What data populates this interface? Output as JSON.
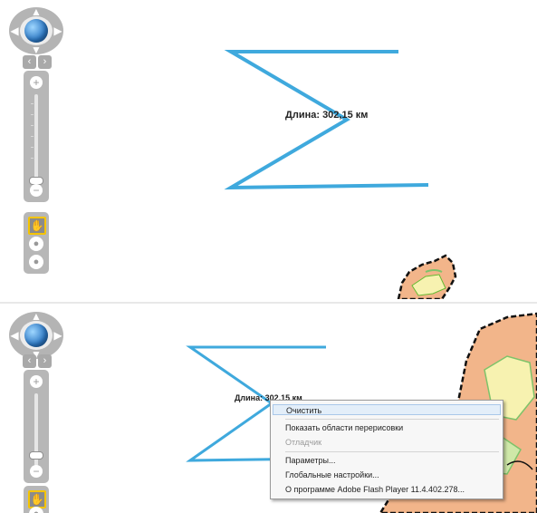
{
  "colors": {
    "measure_line": "#3fa9dd",
    "map_border": "#111111",
    "map_fill": "#f2b58a",
    "map_green": "#7ec36a",
    "accent_selected": "#f5c400"
  },
  "panels": [
    {
      "measure_label": "Длина: 302,15 км",
      "nav_icons": {
        "pan_up": "chevron-up-icon",
        "pan_down": "chevron-down-icon",
        "pan_left": "chevron-left-icon",
        "pan_right": "chevron-right-icon",
        "globe": "globe-icon",
        "rotate_left": "rotate-left-icon",
        "rotate_right": "rotate-right-icon",
        "zoom_in": "plus-icon",
        "zoom_out": "minus-icon",
        "hand": "hand-icon",
        "tool2": "circle-tool-icon",
        "tool3": "circle-tool-icon"
      },
      "zoom_level": 0.2
    },
    {
      "measure_label": "Длина: 302,15 км",
      "zoom_level": 0.15
    }
  ],
  "context_menu": {
    "items": [
      {
        "label": "Очистить",
        "state": "highlighted"
      },
      {
        "label": "Показать области перерисовки",
        "state": "normal"
      },
      {
        "label": "Отладчик",
        "state": "disabled"
      },
      {
        "label": "Параметры...",
        "state": "normal"
      },
      {
        "label": "Глобальные настройки...",
        "state": "normal"
      },
      {
        "label": "О программе Adobe Flash Player 11.4.402.278...",
        "state": "normal"
      }
    ]
  }
}
